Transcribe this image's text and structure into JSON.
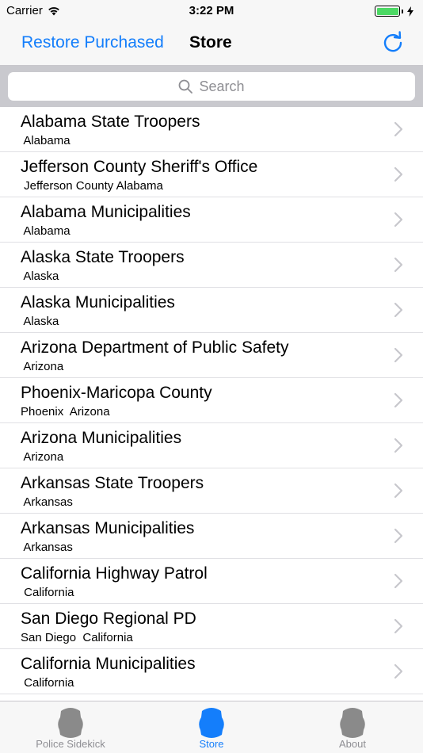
{
  "status_bar": {
    "carrier": "Carrier",
    "time": "3:22 PM"
  },
  "nav": {
    "left_button": "Restore Purchased",
    "title": "Store",
    "right_icon": "refresh-icon"
  },
  "search": {
    "placeholder": "Search"
  },
  "list": {
    "rows": [
      {
        "title": "Alabama State Troopers",
        "subtitle": " Alabama"
      },
      {
        "title": "Jefferson County Sheriff's Office",
        "subtitle": " Jefferson County Alabama"
      },
      {
        "title": "Alabama Municipalities",
        "subtitle": " Alabama"
      },
      {
        "title": "Alaska State Troopers",
        "subtitle": " Alaska"
      },
      {
        "title": "Alaska Municipalities",
        "subtitle": " Alaska"
      },
      {
        "title": "Arizona Department of Public Safety",
        "subtitle": " Arizona"
      },
      {
        "title": "Phoenix-Maricopa County",
        "subtitle": "Phoenix  Arizona"
      },
      {
        "title": "Arizona Municipalities",
        "subtitle": " Arizona"
      },
      {
        "title": "Arkansas State Troopers",
        "subtitle": " Arkansas"
      },
      {
        "title": "Arkansas Municipalities",
        "subtitle": " Arkansas"
      },
      {
        "title": "California Highway Patrol",
        "subtitle": " California"
      },
      {
        "title": "San Diego Regional PD",
        "subtitle": "San Diego  California"
      },
      {
        "title": "California Municipalities",
        "subtitle": " California"
      }
    ]
  },
  "tabs": [
    {
      "label": "Police Sidekick",
      "icon": "badge-icon",
      "active": false
    },
    {
      "label": "Store",
      "icon": "badge-icon",
      "active": true
    },
    {
      "label": "About",
      "icon": "badge-icon",
      "active": false
    }
  ],
  "colors": {
    "accent": "#147efb",
    "battery": "#4cd964",
    "tab_inactive_icon": "#8a8a8a"
  }
}
